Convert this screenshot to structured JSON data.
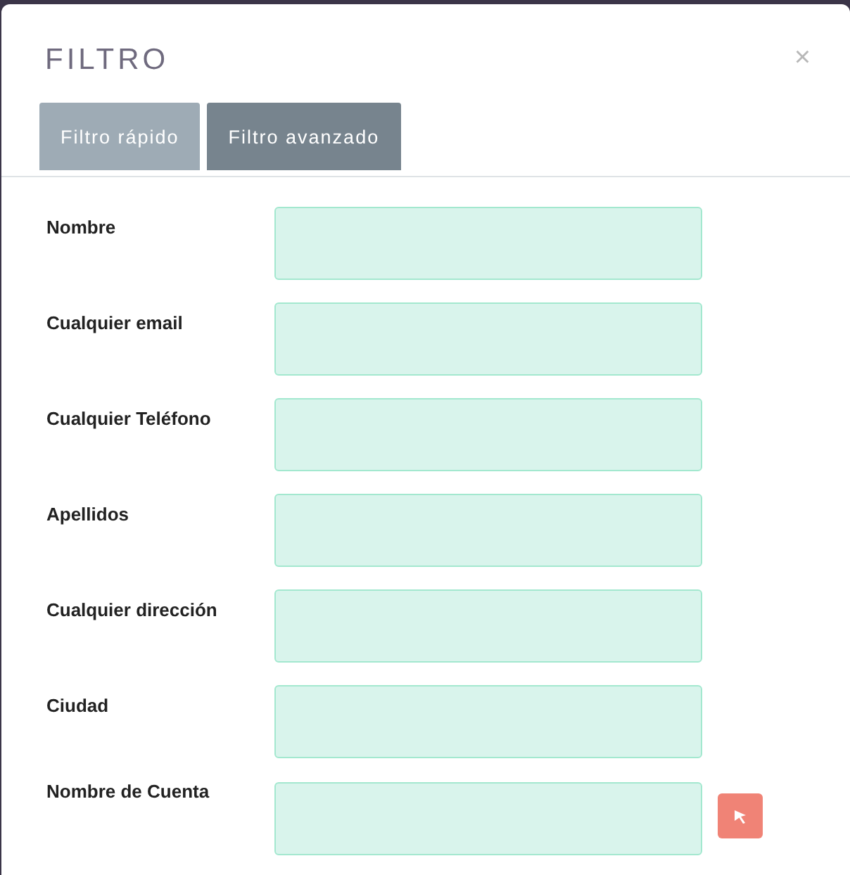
{
  "dialog": {
    "title": "FILTRO",
    "close": "×"
  },
  "tabs": [
    {
      "label": "Filtro rápido",
      "selected": false
    },
    {
      "label": "Filtro avanzado",
      "selected": true
    }
  ],
  "fields": [
    {
      "label": "Nombre",
      "kind": "text"
    },
    {
      "label": "Cualquier email",
      "kind": "text"
    },
    {
      "label": "Cualquier Teléfono",
      "kind": "text"
    },
    {
      "label": "Apellidos",
      "kind": "text"
    },
    {
      "label": "Cualquier dirección",
      "kind": "text"
    },
    {
      "label": "Ciudad",
      "kind": "text"
    },
    {
      "label": "Nombre de Cuenta",
      "kind": "lookup"
    }
  ]
}
